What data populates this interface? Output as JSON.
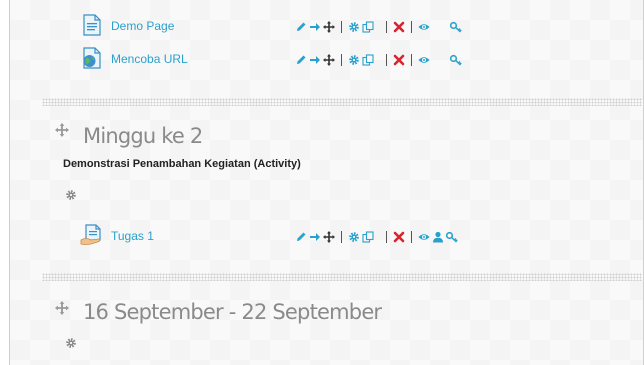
{
  "activities": [
    {
      "name": "Demo Page",
      "icon": "page-icon"
    },
    {
      "name": "Mencoba URL",
      "icon": "url-icon"
    },
    {
      "name": "Tugas 1",
      "icon": "assignment-icon"
    }
  ],
  "sections": [
    {
      "title": "Minggu ke 2",
      "summary": "Demonstrasi Penambahan Kegiatan (Activity)"
    },
    {
      "title": "16 September - 22 September",
      "summary": ""
    }
  ],
  "colors": {
    "link": "#2aa1cc",
    "edit_icons": "#2aa1cc",
    "delete": "#d9232d",
    "section_title": "#8a8a8a"
  }
}
